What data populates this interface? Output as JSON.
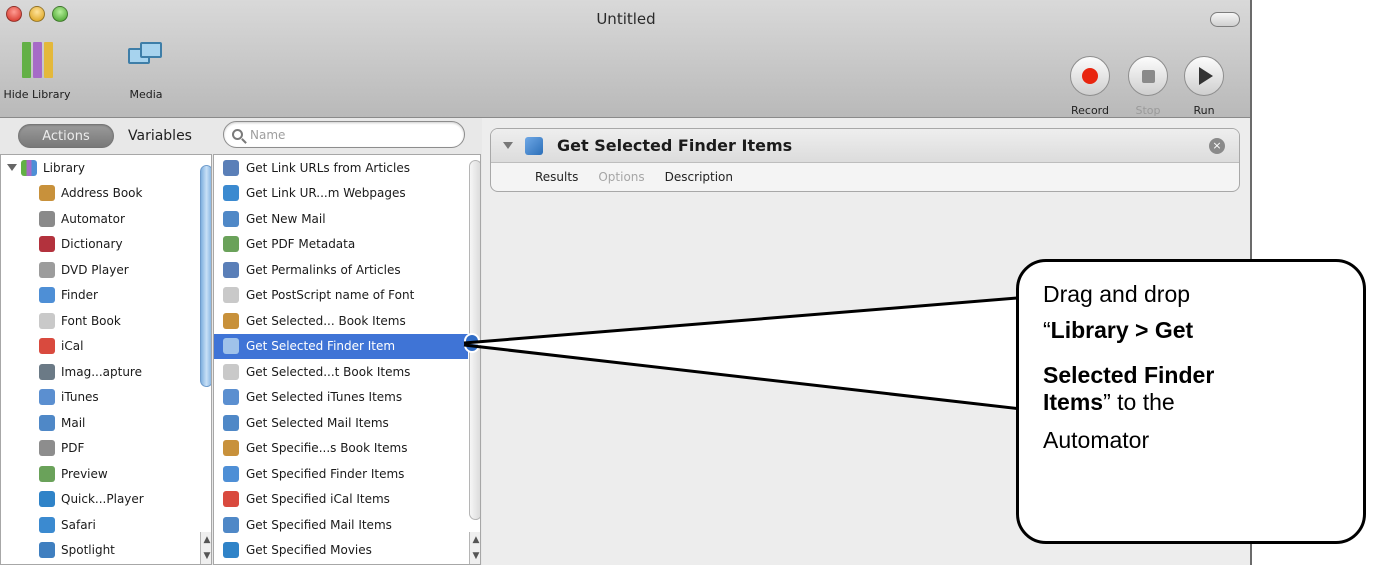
{
  "window": {
    "title": "Untitled"
  },
  "toolbar": {
    "hide_library_label": "Hide Library",
    "media_label": "Media",
    "record_label": "Record",
    "stop_label": "Stop",
    "run_label": "Run"
  },
  "library_pane": {
    "tabs": {
      "actions": "Actions",
      "variables": "Variables"
    },
    "search_placeholder": "Name",
    "root": "Library",
    "items": [
      {
        "label": "Address Book",
        "icon": "address-book-icon",
        "color": "#c8913b"
      },
      {
        "label": "Automator",
        "icon": "automator-icon",
        "color": "#8a8a8a"
      },
      {
        "label": "Dictionary",
        "icon": "dictionary-icon",
        "color": "#b3323d"
      },
      {
        "label": "DVD Player",
        "icon": "dvd-player-icon",
        "color": "#9c9c9c"
      },
      {
        "label": "Finder",
        "icon": "finder-icon",
        "color": "#4e8fd6"
      },
      {
        "label": "Font Book",
        "icon": "font-book-icon",
        "color": "#c9c9c9"
      },
      {
        "label": "iCal",
        "icon": "ical-icon",
        "color": "#d94a3e"
      },
      {
        "label": "Imag...apture",
        "icon": "image-capture-icon",
        "color": "#6b7a86"
      },
      {
        "label": "iTunes",
        "icon": "itunes-icon",
        "color": "#5b8fd0"
      },
      {
        "label": "Mail",
        "icon": "mail-icon",
        "color": "#4f88c7"
      },
      {
        "label": "PDF",
        "icon": "pdf-icon",
        "color": "#8d8d8d"
      },
      {
        "label": "Preview",
        "icon": "preview-icon",
        "color": "#6aa25a"
      },
      {
        "label": "Quick...Player",
        "icon": "quicktime-icon",
        "color": "#2f83c8"
      },
      {
        "label": "Safari",
        "icon": "safari-icon",
        "color": "#3b8ad0"
      },
      {
        "label": "Spotlight",
        "icon": "spotlight-icon",
        "color": "#3f7fc0"
      }
    ]
  },
  "actions_list": {
    "selected_index": 7,
    "items": [
      {
        "label": "Get Link URLs from Articles",
        "icon": "rss-icon",
        "color": "#5a7fb8"
      },
      {
        "label": "Get Link UR...m Webpages",
        "icon": "safari-icon",
        "color": "#3b8ad0"
      },
      {
        "label": "Get New Mail",
        "icon": "mail-icon",
        "color": "#4f88c7"
      },
      {
        "label": "Get PDF Metadata",
        "icon": "preview-icon",
        "color": "#6aa25a"
      },
      {
        "label": "Get Permalinks of Articles",
        "icon": "rss-icon",
        "color": "#5a7fb8"
      },
      {
        "label": "Get PostScript name of Font",
        "icon": "font-book-icon",
        "color": "#c9c9c9"
      },
      {
        "label": "Get Selected... Book Items",
        "icon": "address-book-icon",
        "color": "#c8913b"
      },
      {
        "label": "Get Selected Finder Item",
        "icon": "finder-icon",
        "color": "#9fc2ea"
      },
      {
        "label": "Get Selected...t Book Items",
        "icon": "font-book-icon",
        "color": "#c9c9c9"
      },
      {
        "label": "Get Selected iTunes Items",
        "icon": "itunes-icon",
        "color": "#5b8fd0"
      },
      {
        "label": "Get Selected Mail Items",
        "icon": "mail-icon",
        "color": "#4f88c7"
      },
      {
        "label": "Get Specifie...s Book Items",
        "icon": "address-book-icon",
        "color": "#c8913b"
      },
      {
        "label": "Get Specified Finder Items",
        "icon": "finder-icon",
        "color": "#4e8fd6"
      },
      {
        "label": "Get Specified iCal Items",
        "icon": "ical-icon",
        "color": "#d94a3e"
      },
      {
        "label": "Get Specified Mail Items",
        "icon": "mail-icon",
        "color": "#4f88c7"
      },
      {
        "label": "Get Specified Movies",
        "icon": "quicktime-icon",
        "color": "#2f83c8"
      }
    ]
  },
  "workflow": {
    "action_title": "Get Selected Finder Items",
    "tabs": {
      "results": "Results",
      "options": "Options",
      "description": "Description"
    }
  },
  "callout": {
    "line1": "Drag and drop",
    "quote_open": "“",
    "bold1": "Library > Get",
    "bold2": "Selected Finder",
    "bold3": "Items",
    "rest1": "” to the",
    "rest2": "Automator"
  },
  "colors": {
    "selection": "#3f74d6",
    "record_red": "#e8250f",
    "library_icon": [
      "#63b046",
      "#a66bc7",
      "#e4b83a",
      "#4e8fd6"
    ]
  }
}
